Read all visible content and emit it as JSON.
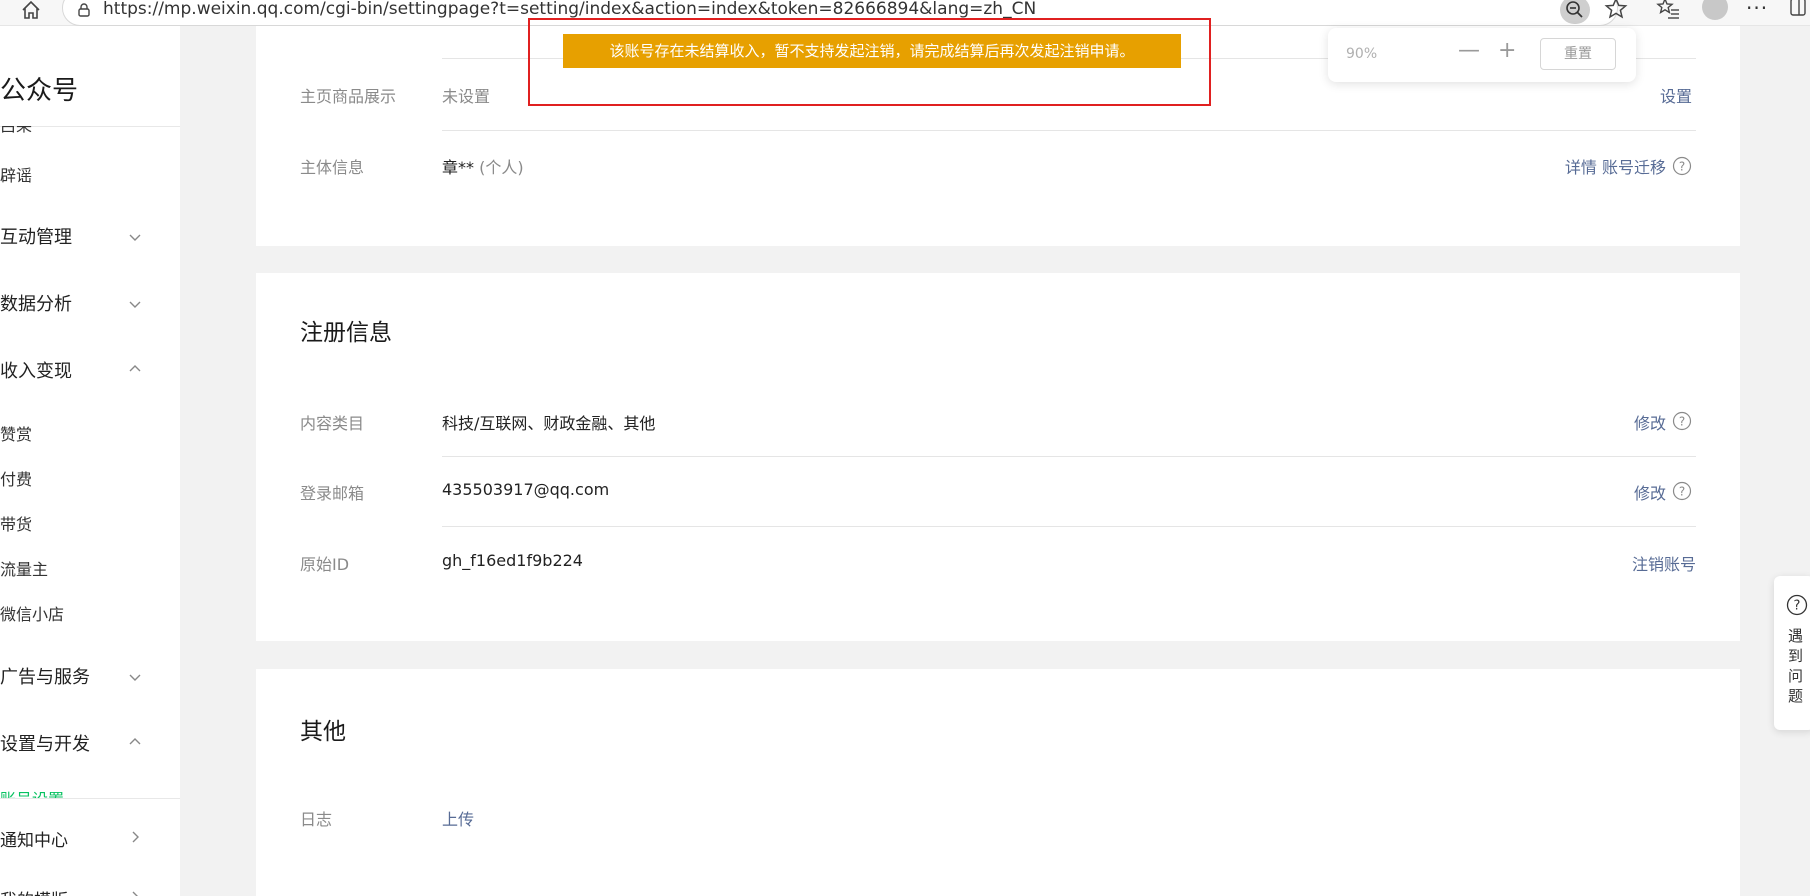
{
  "browser": {
    "url": "https://mp.weixin.qq.com/cgi-bin/settingpage?t=setting/index&action=index&token=82666894&lang=zh_CN"
  },
  "zoom_popup": {
    "level": "90%",
    "minus": "—",
    "plus": "+",
    "reset": "重置"
  },
  "toast": {
    "message": "该账号存在未结算收入，暂不支持发起注销，请完成结算后再次发起注销申请。"
  },
  "sidebar": {
    "brand": "公众号",
    "items": [
      {
        "label": "吕莱",
        "type": "sub"
      },
      {
        "label": "辟谣",
        "type": "sub"
      },
      {
        "label": "互动管理",
        "type": "group",
        "chevron": "down"
      },
      {
        "label": "数据分析",
        "type": "group",
        "chevron": "down"
      },
      {
        "label": "收入变现",
        "type": "group",
        "chevron": "up"
      },
      {
        "label": "赞赏",
        "type": "sub"
      },
      {
        "label": "付费",
        "type": "sub"
      },
      {
        "label": "带货",
        "type": "sub"
      },
      {
        "label": "流量主",
        "type": "sub"
      },
      {
        "label": "微信小店",
        "type": "sub"
      },
      {
        "label": "广告与服务",
        "type": "group",
        "chevron": "down"
      },
      {
        "label": "设置与开发",
        "type": "group",
        "chevron": "up"
      },
      {
        "label": "账号设置",
        "type": "sub",
        "active": true
      },
      {
        "label": "通知中心",
        "type": "group",
        "chevron": "right"
      },
      {
        "label": "我的模版",
        "type": "group",
        "chevron": "right"
      }
    ]
  },
  "account_card": {
    "rows": [
      {
        "label": "主页商品展示",
        "value": "未设置",
        "actions": [
          "设置"
        ]
      },
      {
        "label": "主体信息",
        "value": "章**",
        "value_note": "(个人)",
        "actions": [
          "详情",
          "账号迁移"
        ]
      }
    ]
  },
  "register_card": {
    "title": "注册信息",
    "rows": [
      {
        "label": "内容类目",
        "value": "科技/互联网、财政金融、其他",
        "action": "修改"
      },
      {
        "label": "登录邮箱",
        "value": "435503917@qq.com",
        "action": "修改"
      },
      {
        "label": "原始ID",
        "value": "gh_f16ed1f9b224",
        "action": "注销账号"
      }
    ]
  },
  "other_card": {
    "title": "其他",
    "rows": [
      {
        "label": "日志",
        "action": "上传"
      }
    ]
  },
  "help_float": {
    "label": "遇到问题"
  },
  "colors": {
    "toast_bg": "#e7a000",
    "link": "#576b95",
    "highlight_border": "#e02020",
    "active_nav": "#07c160"
  }
}
